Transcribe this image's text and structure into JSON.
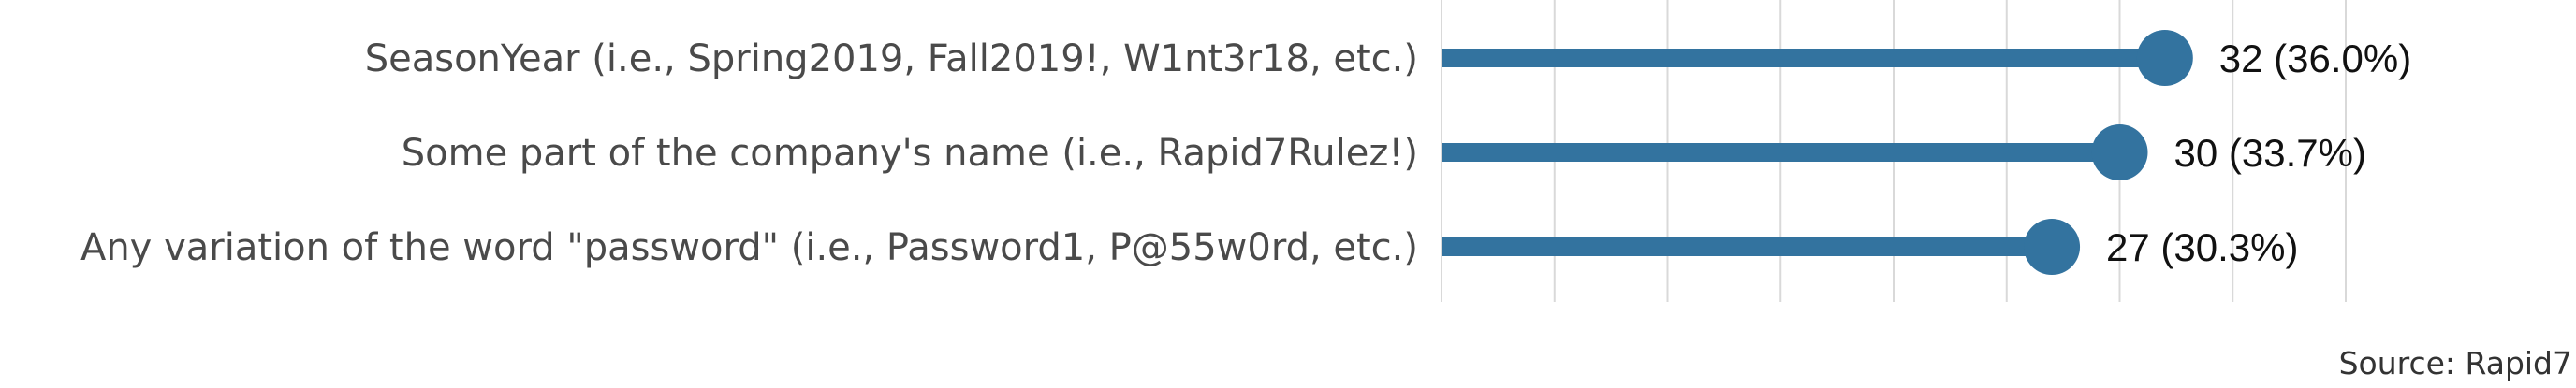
{
  "chart_data": {
    "type": "bar",
    "subtype": "lollipop-horizontal",
    "categories": [
      "SeasonYear (i.e., Spring2019, Fall2019!, W1nt3r18, etc.)",
      "Some part of the company's name (i.e., Rapid7Rulez!)",
      "Any variation of the word \"password\" (i.e., Password1, P@55w0rd, etc.)"
    ],
    "values": [
      32,
      30,
      27
    ],
    "value_labels": [
      "32 (36.0%)",
      "30 (33.7%)",
      "27 (30.3%)"
    ],
    "xlim": [
      0,
      40
    ],
    "grid": true,
    "title": "",
    "xlabel": "",
    "ylabel": "",
    "source": "Source: Rapid7"
  },
  "colors": {
    "series": "#33739f",
    "grid": "#d9d9d9"
  }
}
